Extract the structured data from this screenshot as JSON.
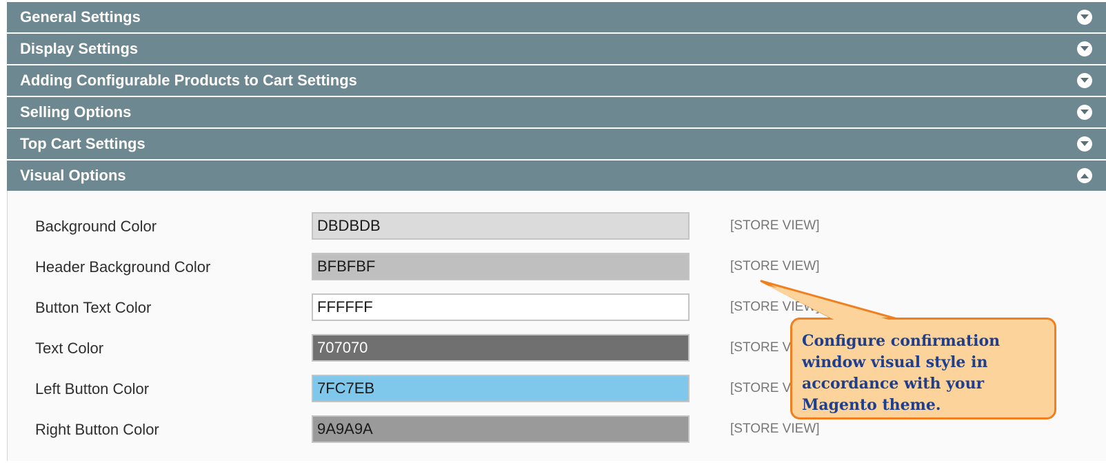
{
  "sections": [
    {
      "title": "General Settings",
      "state": "collapsed",
      "toggle_icon": "chevron-down-icon"
    },
    {
      "title": "Display Settings",
      "state": "collapsed",
      "toggle_icon": "chevron-down-icon"
    },
    {
      "title": "Adding Configurable Products to Cart Settings",
      "state": "collapsed",
      "toggle_icon": "chevron-down-icon"
    },
    {
      "title": "Selling Options",
      "state": "collapsed",
      "toggle_icon": "chevron-down-icon"
    },
    {
      "title": "Top Cart Settings",
      "state": "collapsed",
      "toggle_icon": "chevron-down-icon"
    },
    {
      "title": "Visual Options",
      "state": "expanded",
      "toggle_icon": "chevron-up-icon"
    }
  ],
  "visual_options": {
    "fields": [
      {
        "label": "Background Color",
        "value": "DBDBDB",
        "swatch": "#dbdbdb",
        "text_color": "#1a1a1a",
        "scope": "[STORE VIEW]"
      },
      {
        "label": "Header Background Color",
        "value": "BFBFBF",
        "swatch": "#bfbfbf",
        "text_color": "#1a1a1a",
        "scope": "[STORE VIEW]"
      },
      {
        "label": "Button Text Color",
        "value": "FFFFFF",
        "swatch": "#ffffff",
        "text_color": "#1a1a1a",
        "scope": "[STORE VIEW]"
      },
      {
        "label": "Text Color",
        "value": "707070",
        "swatch": "#707070",
        "text_color": "#ffffff",
        "scope": "[STORE VIEW]"
      },
      {
        "label": "Left Button Color",
        "value": "7FC7EB",
        "swatch": "#7fc7eb",
        "text_color": "#1a1a1a",
        "scope": "[STORE VIEW]"
      },
      {
        "label": "Right Button Color",
        "value": "9A9A9A",
        "swatch": "#9a9a9a",
        "text_color": "#1a1a1a",
        "scope": "[STORE VIEW]"
      }
    ]
  },
  "callout": {
    "text": "Configure confirmation window visual style in accordance with your Magento theme."
  },
  "colors": {
    "header_bg": "#6e8891",
    "callout_bg": "#fbd39b",
    "callout_border": "#f07f1f",
    "callout_text": "#1f3f8c"
  }
}
